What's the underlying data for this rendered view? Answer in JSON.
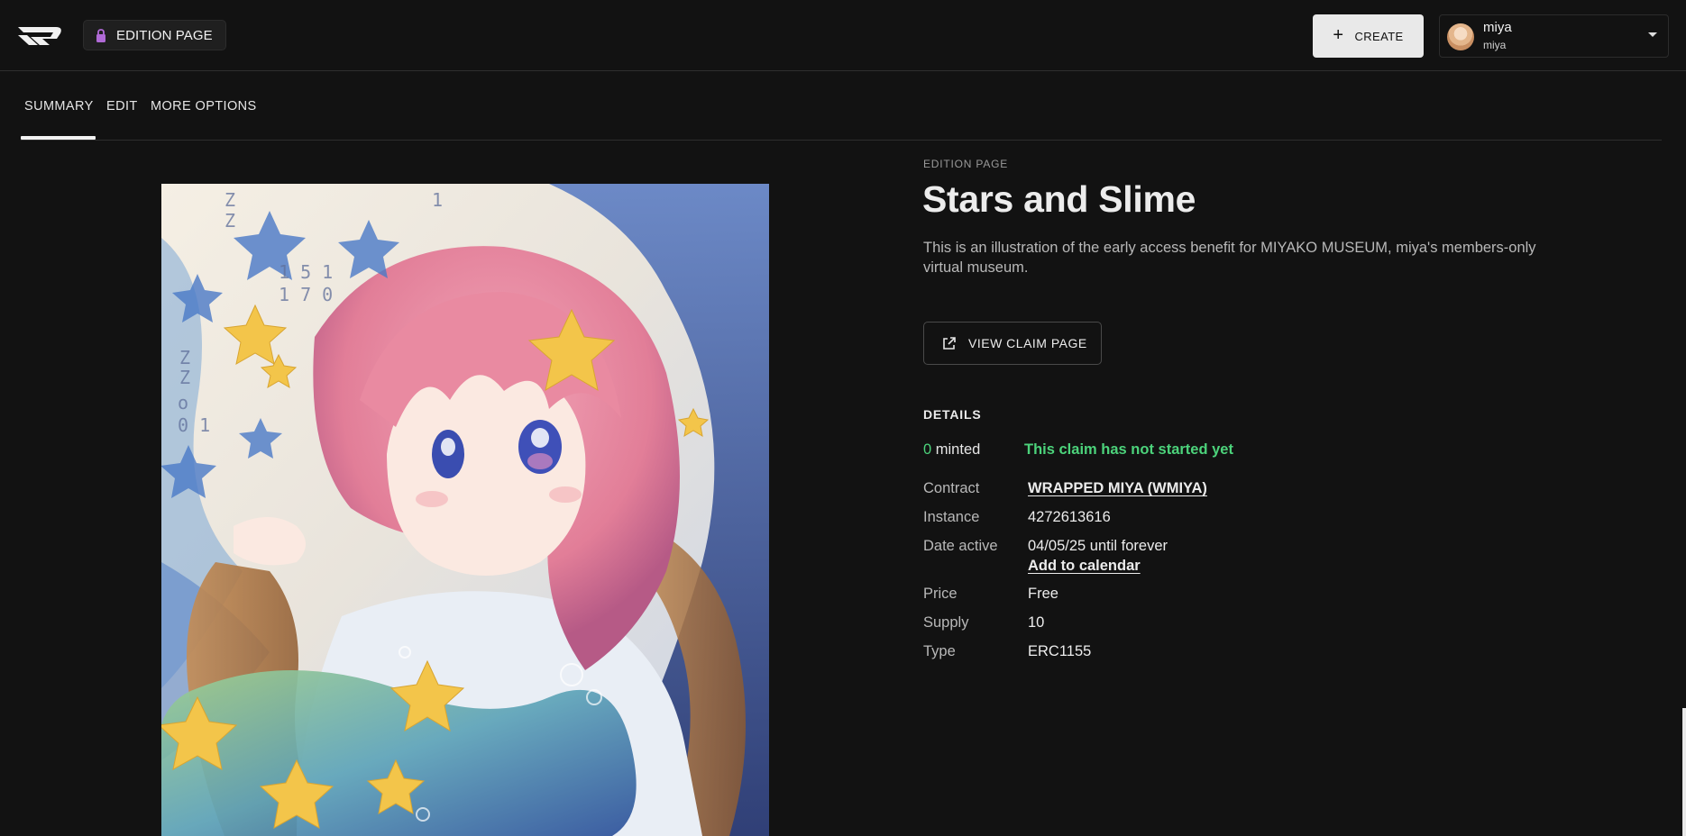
{
  "header": {
    "page_chip_label": "EDITION PAGE",
    "create_label": "CREATE",
    "user": {
      "name": "miya",
      "handle": "miya"
    }
  },
  "tabs": [
    {
      "label": "SUMMARY",
      "active": true
    },
    {
      "label": "EDIT",
      "active": false
    },
    {
      "label": "MORE OPTIONS",
      "active": false
    }
  ],
  "main": {
    "eyebrow": "EDITION PAGE",
    "title": "Stars and Slime",
    "description": "This is an illustration of the early access benefit for MIYAKO MUSEUM, miya's members-only virtual museum.",
    "view_claim_label": "VIEW CLAIM PAGE",
    "details_heading": "DETAILS",
    "minted_count": "0",
    "minted_suffix": " minted",
    "claim_status": "This claim has not started yet",
    "details": {
      "contract": {
        "label": "Contract",
        "value": "WRAPPED MIYA (WMIYA)"
      },
      "instance": {
        "label": "Instance",
        "value": "4272613616"
      },
      "date_active": {
        "label": "Date active",
        "value": "04/05/25 until forever",
        "link": "Add to calendar"
      },
      "price": {
        "label": "Price",
        "value": "Free"
      },
      "supply": {
        "label": "Supply",
        "value": "10"
      },
      "type": {
        "label": "Type",
        "value": "ERC1155"
      }
    }
  },
  "colors": {
    "background": "#121212",
    "accent_green": "#4cd37b",
    "chip_icon": "#b06ad6"
  },
  "icons": {
    "logo": "brand-logo",
    "page_chip": "lock-icon",
    "create": "plus-icon",
    "dropdown": "chevron-down-icon",
    "claim": "external-link-icon"
  }
}
